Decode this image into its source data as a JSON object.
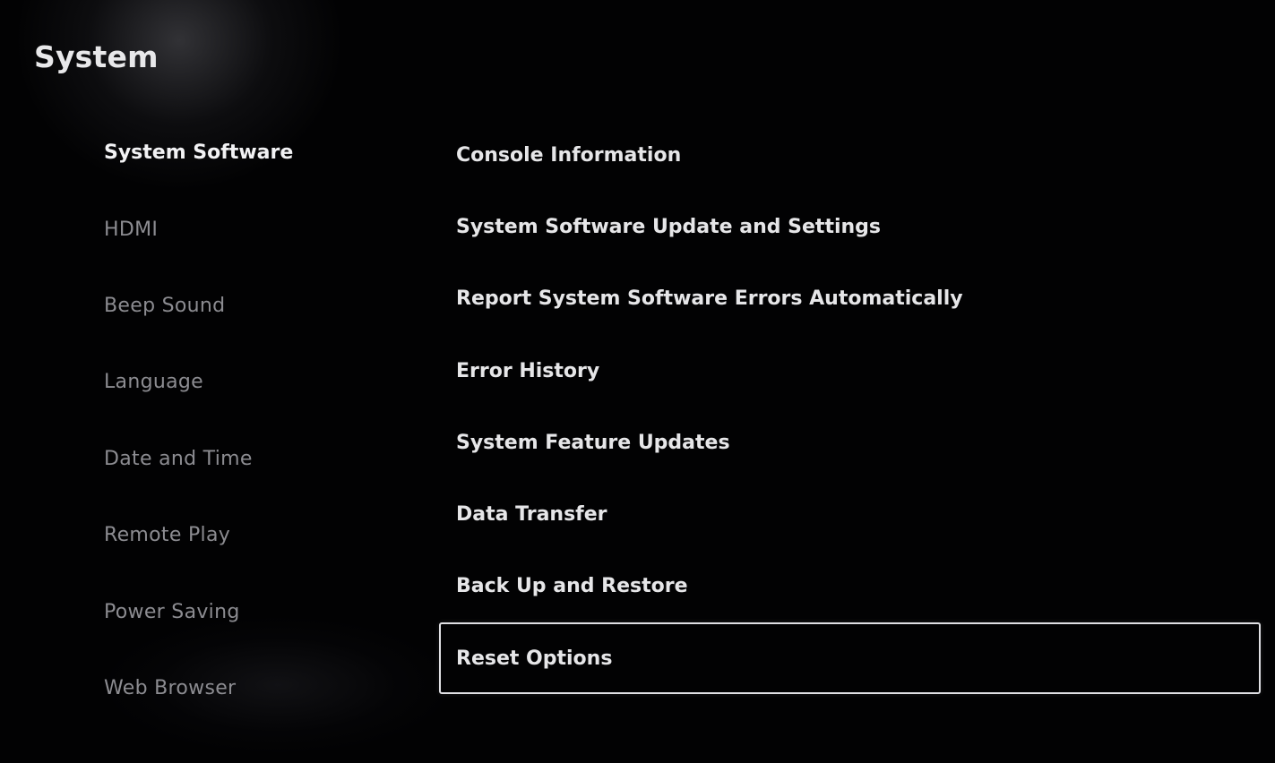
{
  "page": {
    "title": "System"
  },
  "sidebar": {
    "items": [
      {
        "label": "System Software",
        "active": true
      },
      {
        "label": "HDMI",
        "active": false
      },
      {
        "label": "Beep Sound",
        "active": false
      },
      {
        "label": "Language",
        "active": false
      },
      {
        "label": "Date and Time",
        "active": false
      },
      {
        "label": "Remote Play",
        "active": false
      },
      {
        "label": "Power Saving",
        "active": false
      },
      {
        "label": "Web Browser",
        "active": false
      }
    ]
  },
  "options": {
    "items": [
      {
        "label": "Console Information"
      },
      {
        "label": "System Software Update and Settings"
      },
      {
        "label": "Report System Software Errors Automatically"
      },
      {
        "label": "Error History"
      },
      {
        "label": "System Feature Updates"
      },
      {
        "label": "Data Transfer"
      },
      {
        "label": "Back Up and Restore"
      },
      {
        "label": "Reset Options"
      }
    ],
    "focused_index": 7
  },
  "colors": {
    "background": "#020203",
    "text_primary": "#e6e6e8",
    "text_inactive": "#8c8c91",
    "focus_border": "#e0e0e4"
  }
}
